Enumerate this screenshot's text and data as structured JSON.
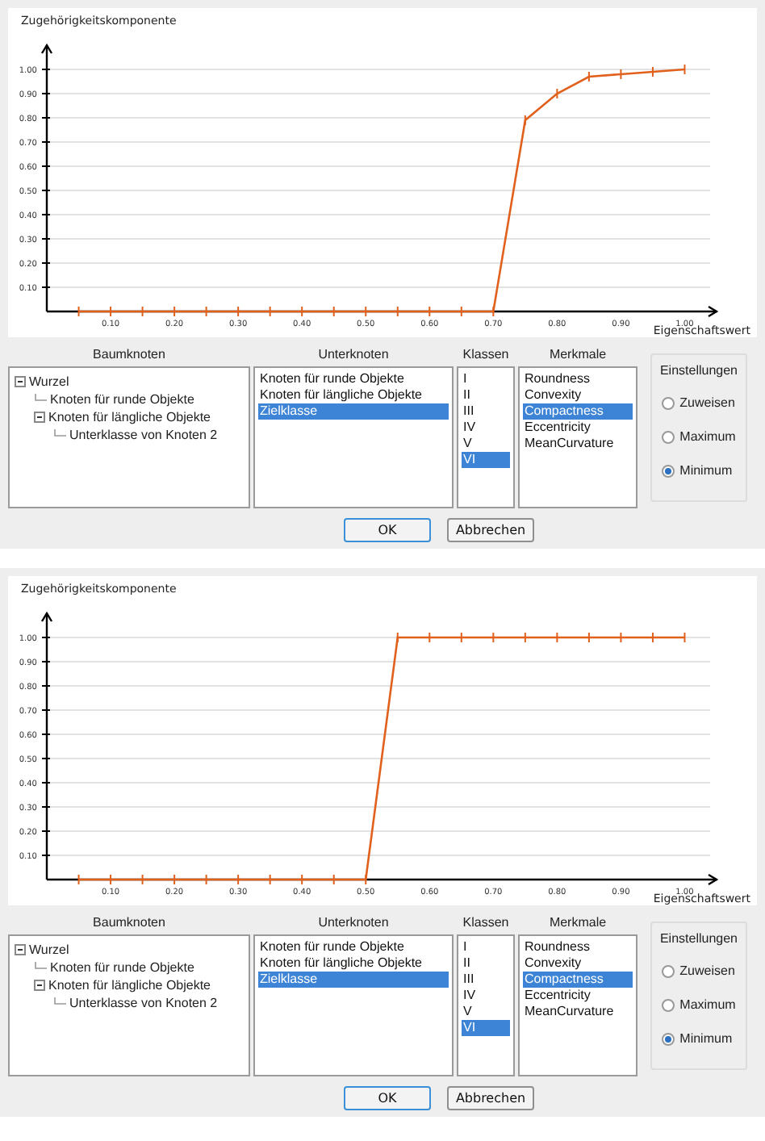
{
  "dialogs": [
    {
      "chart_data": {
        "type": "line",
        "ylabel": "Zugehörigkeitskomponente",
        "xlabel": "Eigenschaftswert",
        "x": [
          0.05,
          0.1,
          0.15,
          0.2,
          0.25,
          0.3,
          0.35,
          0.4,
          0.45,
          0.5,
          0.55,
          0.6,
          0.65,
          0.7,
          0.75,
          0.8,
          0.85,
          0.9,
          0.95,
          1.0
        ],
        "series": [
          {
            "color": "#e0601c",
            "values": [
              0,
              0,
              0,
              0,
              0,
              0,
              0,
              0,
              0,
              0,
              0,
              0,
              0,
              0,
              0.79,
              0.9,
              0.97,
              0.98,
              0.99,
              1.0
            ]
          }
        ],
        "xlim": [
          0,
          1.05
        ],
        "ylim": [
          0,
          1.1
        ],
        "grid": true,
        "xticks": [
          {
            "value": 0.1,
            "label": "0.10"
          },
          {
            "value": 0.2,
            "label": "0.20"
          },
          {
            "value": 0.3,
            "label": "0.30"
          },
          {
            "value": 0.4,
            "label": "0.40"
          },
          {
            "value": 0.5,
            "label": "0.50"
          },
          {
            "value": 0.6,
            "label": "0.60"
          },
          {
            "value": 0.7,
            "label": "0.70"
          },
          {
            "value": 0.8,
            "label": "0.80"
          },
          {
            "value": 0.9,
            "label": "0.90"
          },
          {
            "value": 1.0,
            "label": "1.00"
          }
        ],
        "yticks": [
          {
            "value": 0.1,
            "label": "0.10"
          },
          {
            "value": 0.2,
            "label": "0.20"
          },
          {
            "value": 0.3,
            "label": "0.30"
          },
          {
            "value": 0.4,
            "label": "0.40"
          },
          {
            "value": 0.5,
            "label": "0.50"
          },
          {
            "value": 0.6,
            "label": "0.60"
          },
          {
            "value": 0.7,
            "label": "0.70"
          },
          {
            "value": 0.8,
            "label": "0.80"
          },
          {
            "value": 0.9,
            "label": "0.90"
          },
          {
            "value": 1.0,
            "label": "1.00"
          }
        ]
      },
      "tree": {
        "heading": "Baumknoten",
        "items": [
          {
            "label": "Wurzel",
            "expanded": true,
            "children": [
              {
                "label": "Knoten für runde Objekte"
              },
              {
                "label": "Knoten für längliche Objekte",
                "expanded": true,
                "children": [
                  {
                    "label": "Unterklasse von Knoten 2"
                  }
                ]
              }
            ]
          }
        ]
      },
      "subnodes": {
        "heading": "Unterknoten",
        "items": [
          {
            "label": "Knoten für runde Objekte",
            "selected": false
          },
          {
            "label": "Knoten für längliche Objekte",
            "selected": false
          },
          {
            "label": "Zielklasse",
            "selected": true
          }
        ]
      },
      "classes": {
        "heading": "Klassen",
        "items": [
          {
            "label": "I",
            "selected": false
          },
          {
            "label": "II",
            "selected": false
          },
          {
            "label": "III",
            "selected": false
          },
          {
            "label": "IV",
            "selected": false
          },
          {
            "label": "V",
            "selected": false
          },
          {
            "label": "VI",
            "selected": true
          }
        ]
      },
      "features": {
        "heading": "Merkmale",
        "items": [
          {
            "label": "Roundness",
            "selected": false
          },
          {
            "label": "Convexity",
            "selected": false
          },
          {
            "label": "Compactness",
            "selected": true
          },
          {
            "label": "Eccentricity",
            "selected": false
          },
          {
            "label": "MeanCurvature",
            "selected": false
          }
        ]
      },
      "settings": {
        "title": "Einstellungen",
        "options": [
          {
            "label": "Zuweisen",
            "selected": false
          },
          {
            "label": "Maximum",
            "selected": false
          },
          {
            "label": "Minimum",
            "selected": true
          }
        ]
      },
      "buttons": [
        {
          "label": "OK",
          "default": true
        },
        {
          "label": "Abbrechen",
          "default": false
        }
      ]
    },
    {
      "chart_data": {
        "type": "line",
        "ylabel": "Zugehörigkeitskomponente",
        "xlabel": "Eigenschaftswert",
        "x": [
          0.05,
          0.1,
          0.15,
          0.2,
          0.25,
          0.3,
          0.35,
          0.4,
          0.45,
          0.5,
          0.55,
          0.6,
          0.65,
          0.7,
          0.75,
          0.8,
          0.85,
          0.9,
          0.95,
          1.0
        ],
        "series": [
          {
            "color": "#e0601c",
            "values": [
              0,
              0,
              0,
              0,
              0,
              0,
              0,
              0,
              0,
              0,
              1.0,
              1.0,
              1.0,
              1.0,
              1.0,
              1.0,
              1.0,
              1.0,
              1.0,
              1.0
            ]
          }
        ],
        "xlim": [
          0,
          1.05
        ],
        "ylim": [
          0,
          1.1
        ],
        "grid": true,
        "xticks": [
          {
            "value": 0.1,
            "label": "0.10"
          },
          {
            "value": 0.2,
            "label": "0.20"
          },
          {
            "value": 0.3,
            "label": "0.30"
          },
          {
            "value": 0.4,
            "label": "0.40"
          },
          {
            "value": 0.5,
            "label": "0.50"
          },
          {
            "value": 0.6,
            "label": "0.60"
          },
          {
            "value": 0.7,
            "label": "0.70"
          },
          {
            "value": 0.8,
            "label": "0.80"
          },
          {
            "value": 0.9,
            "label": "0.90"
          },
          {
            "value": 1.0,
            "label": "1.00"
          }
        ],
        "yticks": [
          {
            "value": 0.1,
            "label": "0.10"
          },
          {
            "value": 0.2,
            "label": "0.20"
          },
          {
            "value": 0.3,
            "label": "0.30"
          },
          {
            "value": 0.4,
            "label": "0.40"
          },
          {
            "value": 0.5,
            "label": "0.50"
          },
          {
            "value": 0.6,
            "label": "0.60"
          },
          {
            "value": 0.7,
            "label": "0.70"
          },
          {
            "value": 0.8,
            "label": "0.80"
          },
          {
            "value": 0.9,
            "label": "0.90"
          },
          {
            "value": 1.0,
            "label": "1.00"
          }
        ]
      },
      "tree": {
        "heading": "Baumknoten",
        "items": [
          {
            "label": "Wurzel",
            "expanded": true,
            "children": [
              {
                "label": "Knoten für runde Objekte"
              },
              {
                "label": "Knoten für längliche Objekte",
                "expanded": true,
                "children": [
                  {
                    "label": "Unterklasse von Knoten 2"
                  }
                ]
              }
            ]
          }
        ]
      },
      "subnodes": {
        "heading": "Unterknoten",
        "items": [
          {
            "label": "Knoten für runde Objekte",
            "selected": false
          },
          {
            "label": "Knoten für längliche Objekte",
            "selected": false
          },
          {
            "label": "Zielklasse",
            "selected": true
          }
        ]
      },
      "classes": {
        "heading": "Klassen",
        "items": [
          {
            "label": "I",
            "selected": false
          },
          {
            "label": "II",
            "selected": false
          },
          {
            "label": "III",
            "selected": false
          },
          {
            "label": "IV",
            "selected": false
          },
          {
            "label": "V",
            "selected": false
          },
          {
            "label": "VI",
            "selected": true
          }
        ]
      },
      "features": {
        "heading": "Merkmale",
        "items": [
          {
            "label": "Roundness",
            "selected": false
          },
          {
            "label": "Convexity",
            "selected": false
          },
          {
            "label": "Compactness",
            "selected": true
          },
          {
            "label": "Eccentricity",
            "selected": false
          },
          {
            "label": "MeanCurvature",
            "selected": false
          }
        ]
      },
      "settings": {
        "title": "Einstellungen",
        "options": [
          {
            "label": "Zuweisen",
            "selected": false
          },
          {
            "label": "Maximum",
            "selected": false
          },
          {
            "label": "Minimum",
            "selected": true
          }
        ]
      },
      "buttons": [
        {
          "label": "OK",
          "default": true
        },
        {
          "label": "Abbrechen",
          "default": false
        }
      ]
    }
  ]
}
